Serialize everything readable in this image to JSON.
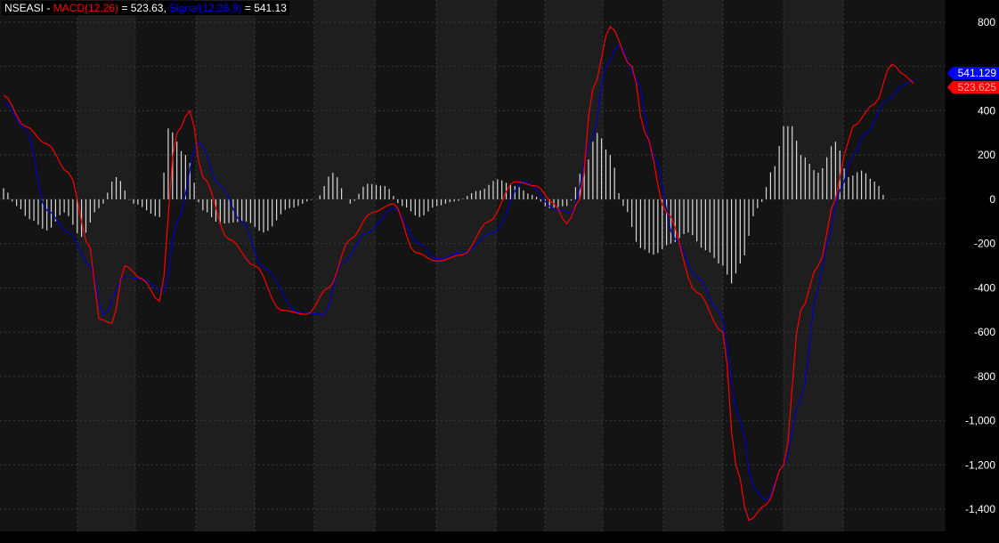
{
  "header": {
    "symbol": "NSEASI",
    "separator": " - ",
    "macd_label": "MACD(12,26)",
    "macd_eq": " = ",
    "macd_value": "523.63",
    "comma": ", ",
    "signal_label": "Signal(12,26,9)",
    "signal_eq": " = ",
    "signal_value": "541.13"
  },
  "colors": {
    "background": "#000000",
    "panel_dark": "#141414",
    "panel_light": "#1e1e1e",
    "macd": "#ff0000",
    "signal": "#0000cc",
    "histogram": "#d9d9d9",
    "axis_text": "#ffffff",
    "grid": "#3a3a3a",
    "signal_tag": "#0000ff",
    "macd_tag": "#ff0000"
  },
  "chart_data": {
    "type": "line",
    "title": "NSEASI - MACD(12,26) = 523.63, Signal(12,26,9) = 541.13",
    "xlabel": "",
    "ylabel": "",
    "ylim": [
      -1500,
      900
    ],
    "y_ticks": [
      800,
      600,
      400,
      200,
      0,
      -200,
      -400,
      -600,
      -800,
      -1000,
      -1200,
      -1400
    ],
    "y_tick_labels": [
      "800",
      "",
      "400",
      "200",
      "0",
      "-200",
      "-400",
      "-600",
      "-800",
      "-1,000",
      "-1,200",
      "-1,400"
    ],
    "grid": true,
    "last_value_tags": [
      {
        "label": "541.129",
        "value": 541.129,
        "color": "#0000ff"
      },
      {
        "label": "523.625",
        "value": 523.625,
        "color": "#ff0000"
      }
    ],
    "x_count": 211,
    "series": [
      {
        "name": "MACD(12,26)",
        "style": "line",
        "color": "#ff0000",
        "points": [
          [
            0,
            470
          ],
          [
            5,
            330
          ],
          [
            10,
            250
          ],
          [
            15,
            120
          ],
          [
            20,
            -220
          ],
          [
            22,
            -540
          ],
          [
            25,
            -560
          ],
          [
            28,
            -300
          ],
          [
            32,
            -360
          ],
          [
            36,
            -460
          ],
          [
            40,
            300
          ],
          [
            43,
            400
          ],
          [
            46,
            100
          ],
          [
            52,
            -180
          ],
          [
            58,
            -300
          ],
          [
            64,
            -500
          ],
          [
            70,
            -520
          ],
          [
            75,
            -400
          ],
          [
            80,
            -180
          ],
          [
            85,
            -60
          ],
          [
            90,
            -20
          ],
          [
            95,
            -240
          ],
          [
            100,
            -280
          ],
          [
            106,
            -250
          ],
          [
            112,
            -100
          ],
          [
            118,
            80
          ],
          [
            123,
            60
          ],
          [
            127,
            -20
          ],
          [
            130,
            -110
          ],
          [
            133,
            0
          ],
          [
            136,
            500
          ],
          [
            140,
            780
          ],
          [
            145,
            600
          ],
          [
            148,
            300
          ],
          [
            153,
            -60
          ],
          [
            160,
            -420
          ],
          [
            166,
            -600
          ],
          [
            169,
            -1200
          ],
          [
            172,
            -1450
          ],
          [
            176,
            -1380
          ],
          [
            180,
            -1200
          ],
          [
            184,
            -500
          ],
          [
            188,
            -300
          ],
          [
            192,
            0
          ],
          [
            194,
            200
          ],
          [
            196,
            330
          ],
          [
            201,
            430
          ],
          [
            205,
            610
          ],
          [
            208,
            560
          ],
          [
            210,
            523.63
          ]
        ]
      },
      {
        "name": "Signal(12,26,9)",
        "style": "line",
        "color": "#0000cc",
        "points": [
          [
            0,
            440
          ],
          [
            5,
            320
          ],
          [
            10,
            -50
          ],
          [
            15,
            -150
          ],
          [
            20,
            -300
          ],
          [
            23,
            -520
          ],
          [
            28,
            -350
          ],
          [
            32,
            -360
          ],
          [
            37,
            -420
          ],
          [
            40,
            -100
          ],
          [
            45,
            260
          ],
          [
            50,
            60
          ],
          [
            55,
            -100
          ],
          [
            60,
            -310
          ],
          [
            68,
            -510
          ],
          [
            74,
            -520
          ],
          [
            78,
            -290
          ],
          [
            84,
            -150
          ],
          [
            90,
            -40
          ],
          [
            96,
            -200
          ],
          [
            100,
            -270
          ],
          [
            106,
            -240
          ],
          [
            113,
            -150
          ],
          [
            120,
            80
          ],
          [
            128,
            -50
          ],
          [
            131,
            -60
          ],
          [
            136,
            280
          ],
          [
            139,
            600
          ],
          [
            142,
            700
          ],
          [
            146,
            550
          ],
          [
            150,
            200
          ],
          [
            155,
            -180
          ],
          [
            160,
            -350
          ],
          [
            165,
            -500
          ],
          [
            170,
            -1000
          ],
          [
            173,
            -1300
          ],
          [
            176,
            -1360
          ],
          [
            180,
            -1200
          ],
          [
            184,
            -900
          ],
          [
            188,
            -400
          ],
          [
            190,
            -200
          ],
          [
            193,
            40
          ],
          [
            196,
            200
          ],
          [
            199,
            300
          ],
          [
            204,
            450
          ],
          [
            208,
            520
          ],
          [
            210,
            541.13
          ]
        ]
      },
      {
        "name": "Histogram",
        "style": "bars",
        "color": "#d9d9d9",
        "points": [
          [
            0,
            50
          ],
          [
            3,
            -30
          ],
          [
            6,
            -90
          ],
          [
            10,
            -140
          ],
          [
            14,
            -60
          ],
          [
            18,
            -170
          ],
          [
            22,
            -40
          ],
          [
            26,
            100
          ],
          [
            30,
            -20
          ],
          [
            36,
            -80
          ],
          [
            38,
            320
          ],
          [
            42,
            200
          ],
          [
            46,
            -50
          ],
          [
            50,
            -110
          ],
          [
            56,
            -100
          ],
          [
            60,
            -150
          ],
          [
            66,
            -40
          ],
          [
            72,
            0
          ],
          [
            76,
            120
          ],
          [
            80,
            -20
          ],
          [
            84,
            70
          ],
          [
            88,
            60
          ],
          [
            92,
            -30
          ],
          [
            96,
            -80
          ],
          [
            100,
            -30
          ],
          [
            104,
            -10
          ],
          [
            110,
            40
          ],
          [
            114,
            90
          ],
          [
            118,
            60
          ],
          [
            122,
            20
          ],
          [
            126,
            -40
          ],
          [
            130,
            -30
          ],
          [
            134,
            140
          ],
          [
            137,
            300
          ],
          [
            140,
            200
          ],
          [
            143,
            -30
          ],
          [
            147,
            -220
          ],
          [
            150,
            -250
          ],
          [
            154,
            -200
          ],
          [
            158,
            -150
          ],
          [
            162,
            -230
          ],
          [
            166,
            -300
          ],
          [
            168,
            -380
          ],
          [
            170,
            -290
          ],
          [
            174,
            -40
          ],
          [
            178,
            150
          ],
          [
            180,
            330
          ],
          [
            182,
            330
          ],
          [
            184,
            200
          ],
          [
            188,
            120
          ],
          [
            192,
            260
          ],
          [
            195,
            100
          ],
          [
            198,
            130
          ],
          [
            201,
            80
          ],
          [
            204,
            0
          ]
        ]
      }
    ]
  }
}
